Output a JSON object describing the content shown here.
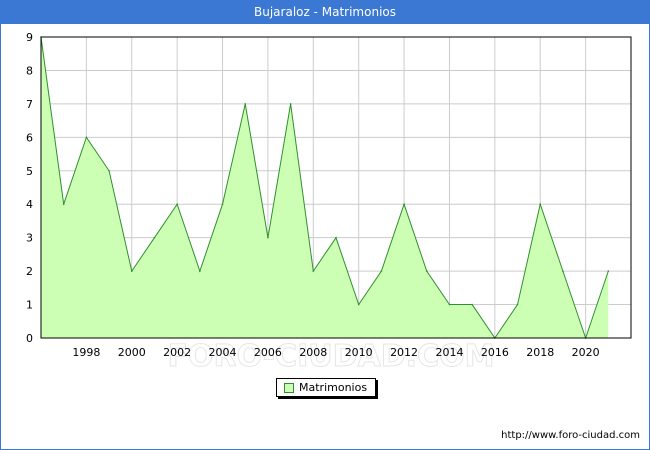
{
  "title": "Bujaraloz - Matrimonios",
  "source": "http://www.foro-ciudad.com",
  "watermark": "FORO-CIUDAD.COM",
  "colors": {
    "title_bar": "#3a78d4",
    "area_fill": "#ccffb3",
    "line": "#2f8f2f",
    "grid": "#cccccc"
  },
  "chart_data": {
    "type": "area",
    "title": "Bujaraloz - Matrimonios",
    "xlabel": "",
    "ylabel": "",
    "x": [
      1996,
      1997,
      1998,
      1999,
      2000,
      2001,
      2002,
      2003,
      2004,
      2005,
      2006,
      2007,
      2008,
      2009,
      2010,
      2011,
      2012,
      2013,
      2014,
      2015,
      2016,
      2017,
      2018,
      2019,
      2020,
      2021
    ],
    "series": [
      {
        "name": "Matrimonios",
        "values": [
          9,
          4,
          6,
          5,
          2,
          3,
          4,
          2,
          4,
          7,
          3,
          7,
          2,
          3,
          1,
          2,
          4,
          2,
          1,
          1,
          0,
          1,
          4,
          2,
          0,
          2
        ]
      }
    ],
    "xlim": [
      1996,
      2022
    ],
    "ylim": [
      0,
      9
    ],
    "x_ticks": [
      1998,
      2000,
      2002,
      2004,
      2006,
      2008,
      2010,
      2012,
      2014,
      2016,
      2018,
      2020
    ],
    "y_ticks": [
      0,
      1,
      2,
      3,
      4,
      5,
      6,
      7,
      8,
      9
    ],
    "grid": true,
    "legend_position": "bottom-center"
  }
}
